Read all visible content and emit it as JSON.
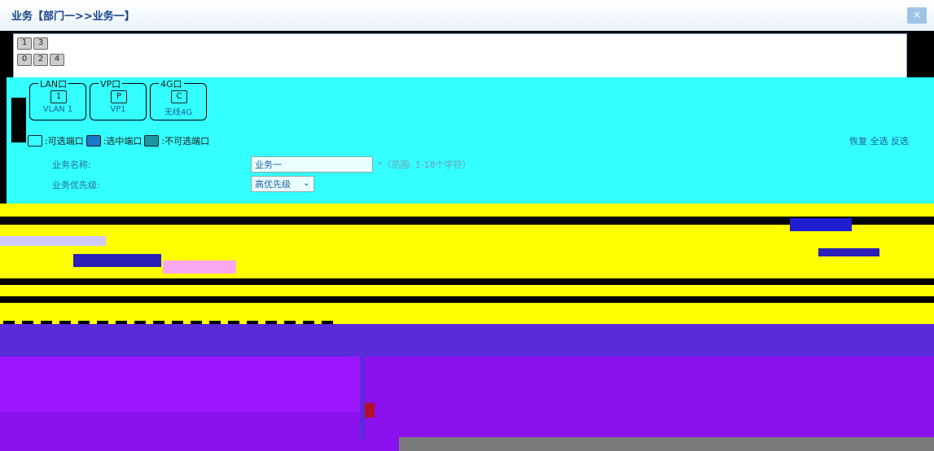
{
  "title": "业务【部门一>>业务一】",
  "close_symbol": "×",
  "port_rows": [
    [
      "1",
      "3"
    ],
    [
      "0",
      "2",
      "4"
    ]
  ],
  "port_groups": [
    {
      "caption": "LAN口",
      "items": [
        {
          "icon": "1",
          "label": "VLAN 1"
        }
      ]
    },
    {
      "caption": "VP口",
      "items": [
        {
          "icon": "P",
          "label": "VP1"
        }
      ]
    },
    {
      "caption": "4G口",
      "items": [
        {
          "icon": "C",
          "label": "无线4G"
        }
      ]
    }
  ],
  "legend": {
    "selectable": ":可选端口",
    "selected": ":选中端口",
    "unselectable": ":不可选端口",
    "actions": "恢复 全选 反选"
  },
  "form": {
    "name_label": "业务名称:",
    "name_value": "业务一",
    "name_hint": "*（范围: 1-18个字符）",
    "priority_label": "业务优先级:",
    "priority_value": "高优先级"
  },
  "colors": {
    "cyan": "#33ffff",
    "yellow": "#ffff00",
    "purple": "#8b11ef",
    "title": "#15428b"
  }
}
